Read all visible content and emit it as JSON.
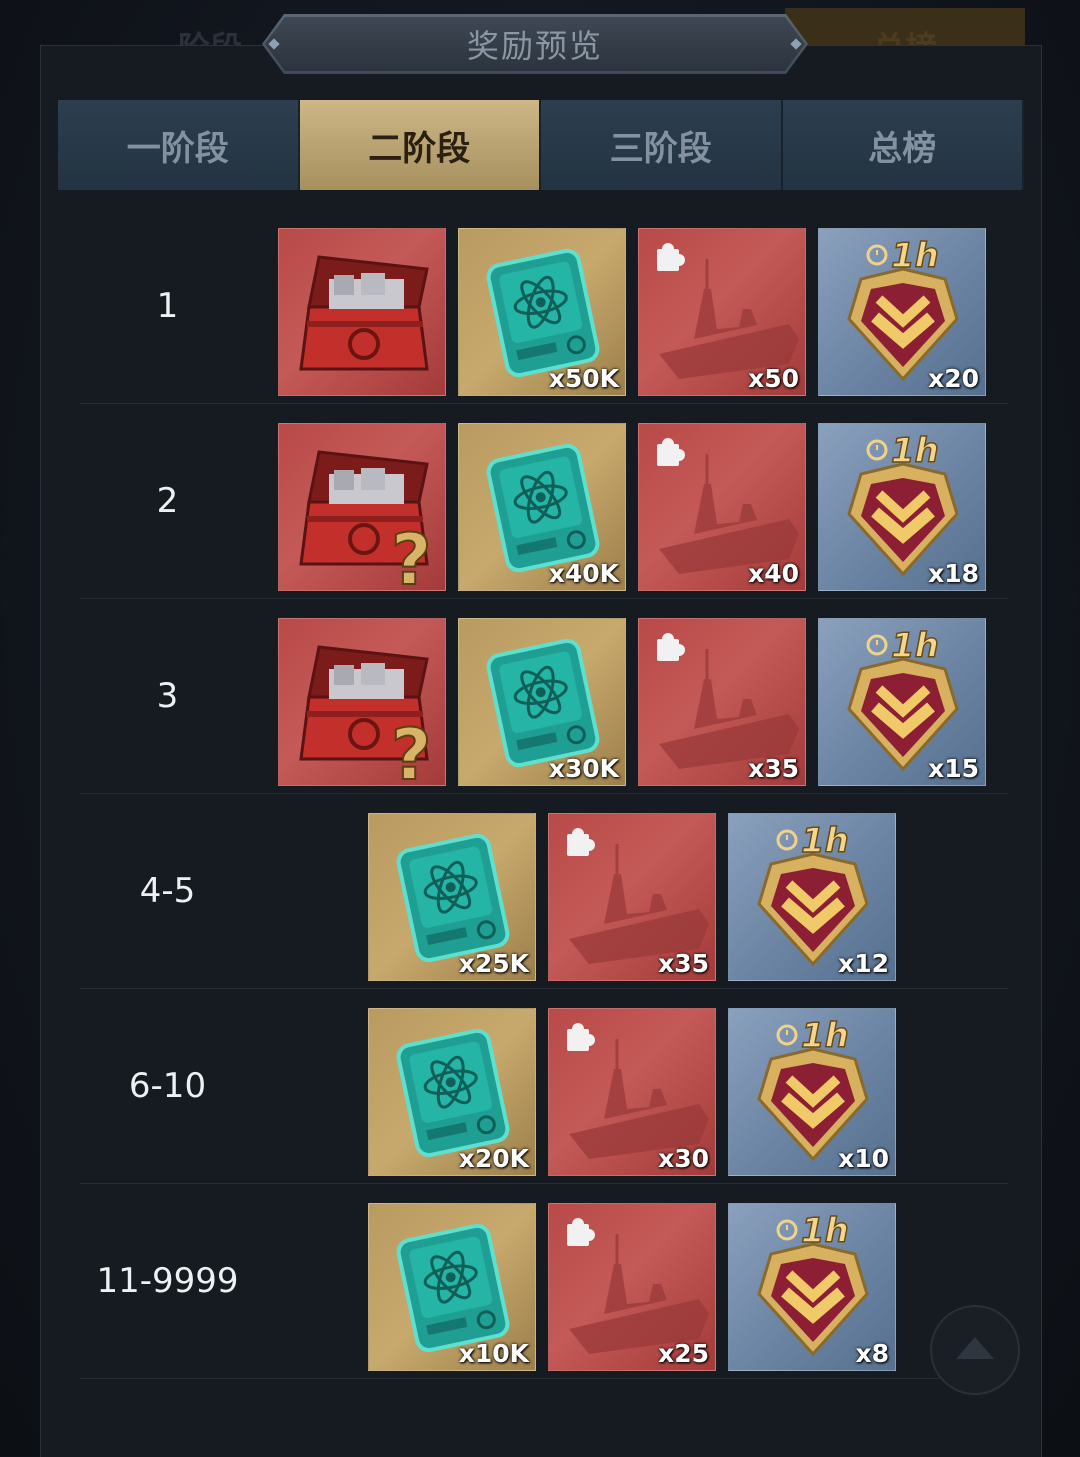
{
  "background_tabs": [
    "阶段",
    "总榜"
  ],
  "title": "奖励预览",
  "tabs": [
    {
      "label": "一阶段",
      "active": false
    },
    {
      "label": "二阶段",
      "active": true
    },
    {
      "label": "三阶段",
      "active": false
    },
    {
      "label": "总榜",
      "active": false
    }
  ],
  "rows": [
    {
      "rank": "1",
      "items": [
        {
          "icon": "crate-icon",
          "bg": "red",
          "qty": ""
        },
        {
          "icon": "blueprint-card-icon",
          "bg": "gold",
          "qty": "x50K"
        },
        {
          "icon": "ship-fragment-icon",
          "bg": "red",
          "qty": "x50"
        },
        {
          "icon": "badge-1h-icon",
          "bg": "blue",
          "qty": "x20"
        }
      ]
    },
    {
      "rank": "2",
      "items": [
        {
          "icon": "mystery-crate-icon",
          "bg": "red",
          "qty": ""
        },
        {
          "icon": "blueprint-card-icon",
          "bg": "gold",
          "qty": "x40K"
        },
        {
          "icon": "ship-fragment-icon",
          "bg": "red",
          "qty": "x40"
        },
        {
          "icon": "badge-1h-icon",
          "bg": "blue",
          "qty": "x18"
        }
      ]
    },
    {
      "rank": "3",
      "items": [
        {
          "icon": "mystery-crate-icon",
          "bg": "red",
          "qty": ""
        },
        {
          "icon": "blueprint-card-icon",
          "bg": "gold",
          "qty": "x30K"
        },
        {
          "icon": "ship-fragment-icon",
          "bg": "red",
          "qty": "x35"
        },
        {
          "icon": "badge-1h-icon",
          "bg": "blue",
          "qty": "x15"
        }
      ]
    },
    {
      "rank": "4-5",
      "items": [
        {
          "icon": "blueprint-card-icon",
          "bg": "gold",
          "qty": "x25K"
        },
        {
          "icon": "ship-fragment-icon",
          "bg": "red",
          "qty": "x35"
        },
        {
          "icon": "badge-1h-icon",
          "bg": "blue",
          "qty": "x12"
        }
      ]
    },
    {
      "rank": "6-10",
      "items": [
        {
          "icon": "blueprint-card-icon",
          "bg": "gold",
          "qty": "x20K"
        },
        {
          "icon": "ship-fragment-icon",
          "bg": "red",
          "qty": "x30"
        },
        {
          "icon": "badge-1h-icon",
          "bg": "blue",
          "qty": "x10"
        }
      ]
    },
    {
      "rank": "11-9999",
      "items": [
        {
          "icon": "blueprint-card-icon",
          "bg": "gold",
          "qty": "x10K"
        },
        {
          "icon": "ship-fragment-icon",
          "bg": "red",
          "qty": "x25"
        },
        {
          "icon": "badge-1h-icon",
          "bg": "blue",
          "qty": "x8"
        }
      ]
    }
  ],
  "badge_text": "1h",
  "mystery_mark": "?"
}
